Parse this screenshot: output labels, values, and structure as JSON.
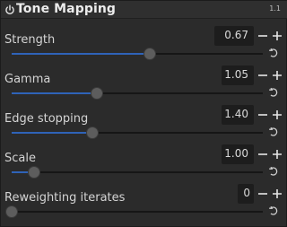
{
  "module": {
    "title": "Tone Mapping",
    "version_badge": "1.1",
    "colors": {
      "accent": "#2f63b8",
      "panel": "#2b2b2b",
      "text": "#d8d8d8"
    }
  },
  "sliders": [
    {
      "label": "Strength",
      "value": "0.67",
      "fraction": 0.55
    },
    {
      "label": "Gamma",
      "value": "1.05",
      "fraction": 0.34
    },
    {
      "label": "Edge stopping",
      "value": "1.40",
      "fraction": 0.32
    },
    {
      "label": "Scale",
      "value": "1.00",
      "fraction": 0.09
    },
    {
      "label": "Reweighting iterates",
      "value": "0",
      "fraction": 0.0
    }
  ],
  "icons": {
    "power": "power-icon",
    "minus": "minus-icon",
    "plus": "plus-icon",
    "reset": "reset-icon"
  }
}
